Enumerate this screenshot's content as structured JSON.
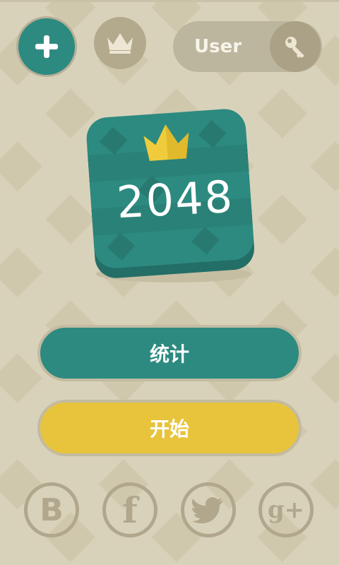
{
  "colors": {
    "background": "#d9d2ba",
    "teal": "#2d8a80",
    "yellow": "#e8c43c",
    "muted": "#b0a78d"
  },
  "header": {
    "add_icon": "plus-icon",
    "crown_icon": "crown-icon",
    "user_label": "User",
    "key_icon": "key-icon"
  },
  "logo": {
    "text": "2048",
    "icon": "crown-icon"
  },
  "buttons": {
    "stats_label": "统计",
    "start_label": "开始"
  },
  "social": [
    {
      "icon": "b-icon",
      "glyph": "B"
    },
    {
      "icon": "facebook-icon",
      "glyph": "f"
    },
    {
      "icon": "twitter-icon",
      "glyph": ""
    },
    {
      "icon": "google-plus-icon",
      "glyph": "g+"
    }
  ]
}
